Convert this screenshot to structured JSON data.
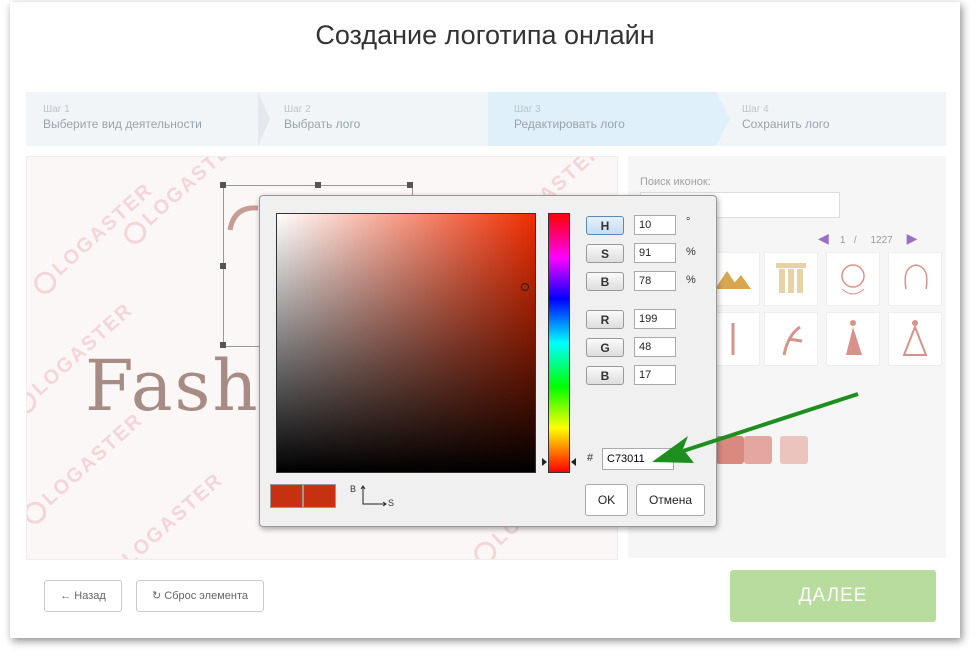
{
  "page": {
    "title": "Создание логотипа онлайн"
  },
  "steps": [
    {
      "num": "Шаг 1",
      "label": "Выберите вид деятельности"
    },
    {
      "num": "Шаг 2",
      "label": "Выбрать лого"
    },
    {
      "num": "Шаг 3",
      "label": "Редактировать лого"
    },
    {
      "num": "Шаг 4",
      "label": "Сохранить лого"
    }
  ],
  "canvas": {
    "logo_text": "Fash",
    "watermark": "LOGASTER"
  },
  "icons_panel": {
    "search_label": "Поиск иконок:",
    "search_value": "",
    "page_current": "1",
    "page_sep": "/",
    "page_total": "1227"
  },
  "swatches": [
    "#d98a80",
    "#e3a79f",
    "#ebc4be"
  ],
  "footer": {
    "back_label": "Назад",
    "reset_label": "Сброс элемента",
    "next_label": "ДАЛЕЕ"
  },
  "color_picker": {
    "fields": [
      {
        "btn": "H",
        "value": "10",
        "unit": "°"
      },
      {
        "btn": "S",
        "value": "91",
        "unit": "%"
      },
      {
        "btn": "B",
        "value": "78",
        "unit": "%"
      },
      {
        "btn": "R",
        "value": "199",
        "unit": ""
      },
      {
        "btn": "G",
        "value": "48",
        "unit": ""
      },
      {
        "btn": "B",
        "value": "17",
        "unit": ""
      }
    ],
    "hash": "#",
    "hex": "C73011",
    "axis_y": "B",
    "axis_x": "S",
    "ok_label": "OK",
    "cancel_label": "Отмена",
    "current_color": "#c73011",
    "previous_color": "#c73011"
  },
  "colors": {
    "accent_green": "#b7dc9d",
    "arrow_green": "#1e8f1e"
  }
}
